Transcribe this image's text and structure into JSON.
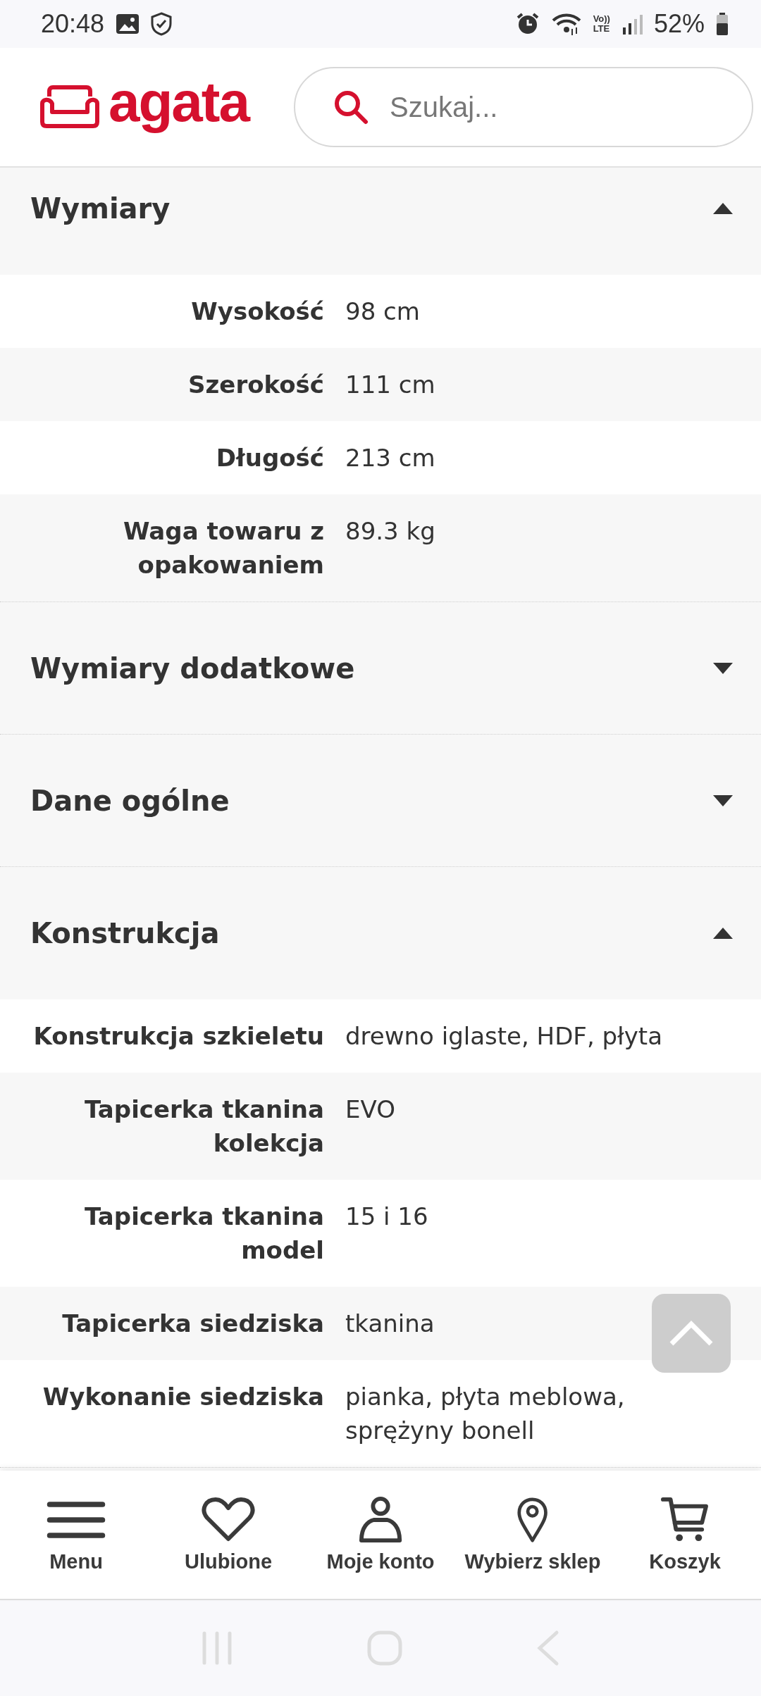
{
  "status_bar": {
    "time": "20:48",
    "network": [
      "Vo))",
      "LTE"
    ],
    "battery_text": "52%"
  },
  "header": {
    "logo": "agata",
    "search": {
      "placeholder": "Szukaj..."
    }
  },
  "sections": [
    {
      "title": "Wymiary",
      "expanded": true,
      "rows": [
        {
          "label": "Wysokość",
          "value": "98 cm"
        },
        {
          "label": "Szerokość",
          "value": "111 cm"
        },
        {
          "label": "Długość",
          "value": "213 cm"
        },
        {
          "label": "Waga towaru z opakowaniem",
          "value": "89.3 kg"
        }
      ]
    },
    {
      "title": "Wymiary dodatkowe",
      "expanded": false
    },
    {
      "title": "Dane ogólne",
      "expanded": false
    },
    {
      "title": "Konstrukcja",
      "expanded": true,
      "rows": [
        {
          "label": "Konstrukcja szkieletu",
          "value": "drewno iglaste, HDF, płyta"
        },
        {
          "label": "Tapicerka tkanina kolekcja",
          "value": "EVO"
        },
        {
          "label": "Tapicerka tkanina model",
          "value": "15 i 16"
        },
        {
          "label": "Tapicerka siedziska",
          "value": "tkanina"
        },
        {
          "label": "Wykonanie siedziska",
          "value": "pianka, płyta meblowa, sprężyny bonell"
        }
      ]
    }
  ],
  "bottom_nav": [
    {
      "kind": "menu",
      "label": "Menu"
    },
    {
      "kind": "heart",
      "label": "Ulubione"
    },
    {
      "kind": "user",
      "label": "Moje konto"
    },
    {
      "kind": "pin",
      "label": "Wybierz sklep"
    },
    {
      "kind": "cart",
      "label": "Koszyk"
    }
  ]
}
